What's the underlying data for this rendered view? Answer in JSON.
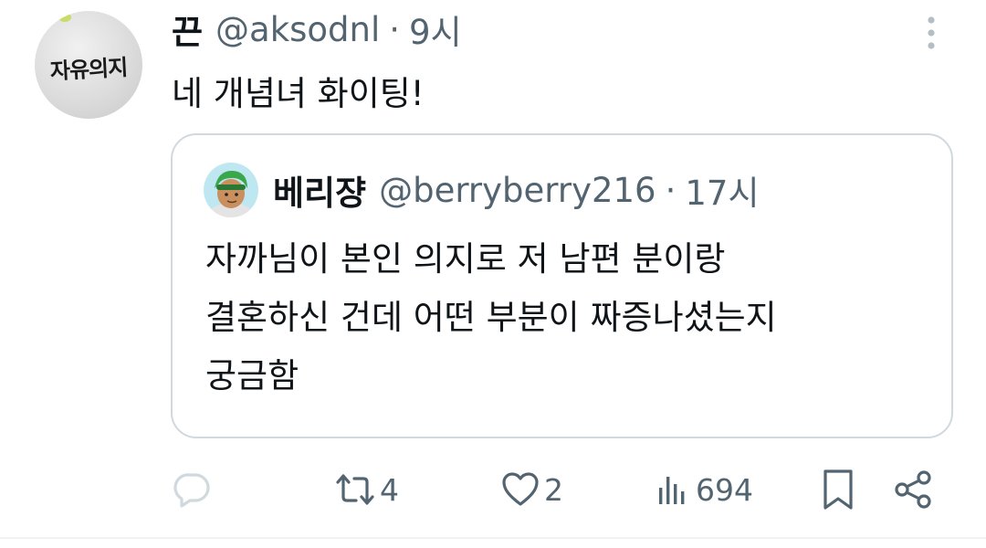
{
  "tweet": {
    "author": {
      "display_name": "끈",
      "handle": "@aksodnl",
      "separator": "·",
      "time": "9시",
      "avatar_text": "자유의지"
    },
    "text": "네 개념녀 화이팅!",
    "more_icon": "more-vertical-icon"
  },
  "quote": {
    "author": {
      "display_name": "베리쟝",
      "handle": "@berryberry216",
      "separator": "·",
      "time": "17시"
    },
    "lines": [
      "자까님이 본인 의지로 저 남편 분이랑",
      "결혼하신 건데 어떤 부분이 짜증나셨는지",
      "궁금함"
    ]
  },
  "actions": {
    "reply": {
      "icon": "reply-icon",
      "count": ""
    },
    "retweet": {
      "icon": "retweet-icon",
      "count": "4"
    },
    "like": {
      "icon": "heart-icon",
      "count": "2"
    },
    "views": {
      "icon": "views-icon",
      "count": "694"
    },
    "bookmark": {
      "icon": "bookmark-icon"
    },
    "share": {
      "icon": "share-icon"
    }
  },
  "colors": {
    "text": "#0f1419",
    "secondary": "#536471",
    "border": "#cfd9de",
    "icon_muted": "#cfd9de"
  }
}
